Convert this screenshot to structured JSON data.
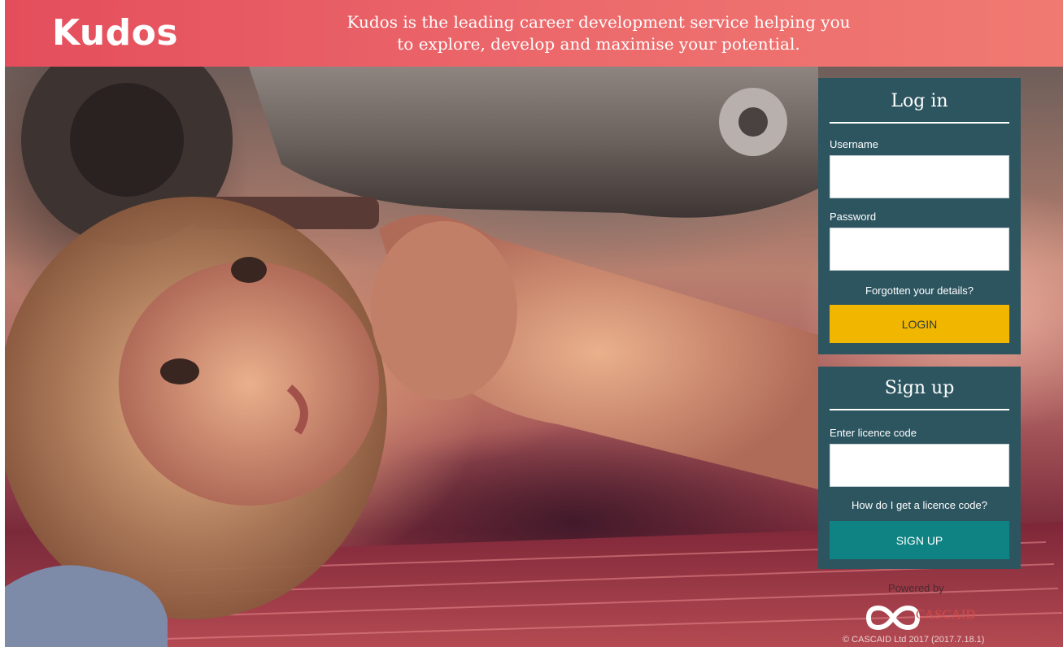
{
  "header": {
    "logo": "Kudos",
    "tagline_line1": "Kudos is the leading career development service helping you",
    "tagline_line2": "to explore, develop and maximise your potential."
  },
  "login": {
    "title": "Log in",
    "username_label": "Username",
    "username_value": "",
    "password_label": "Password",
    "password_value": "",
    "forgot_link": "Forgotten your details?",
    "button": "LOGIN"
  },
  "signup": {
    "title": "Sign up",
    "licence_label": "Enter licence code",
    "licence_value": "",
    "help_link": "How do I get a licence code?",
    "button": "SIGN UP"
  },
  "footer": {
    "powered_by": "Powered by",
    "brand": "CASCAID",
    "version": "© CASCAID Ltd 2017 (2017.7.18.1)"
  },
  "colors": {
    "header": "#e44e5c",
    "panel": "#2d5560",
    "login_button": "#f1b700",
    "signup_button": "#0f8383"
  },
  "icons": {
    "powered_logo": "infinity-logo-icon"
  }
}
